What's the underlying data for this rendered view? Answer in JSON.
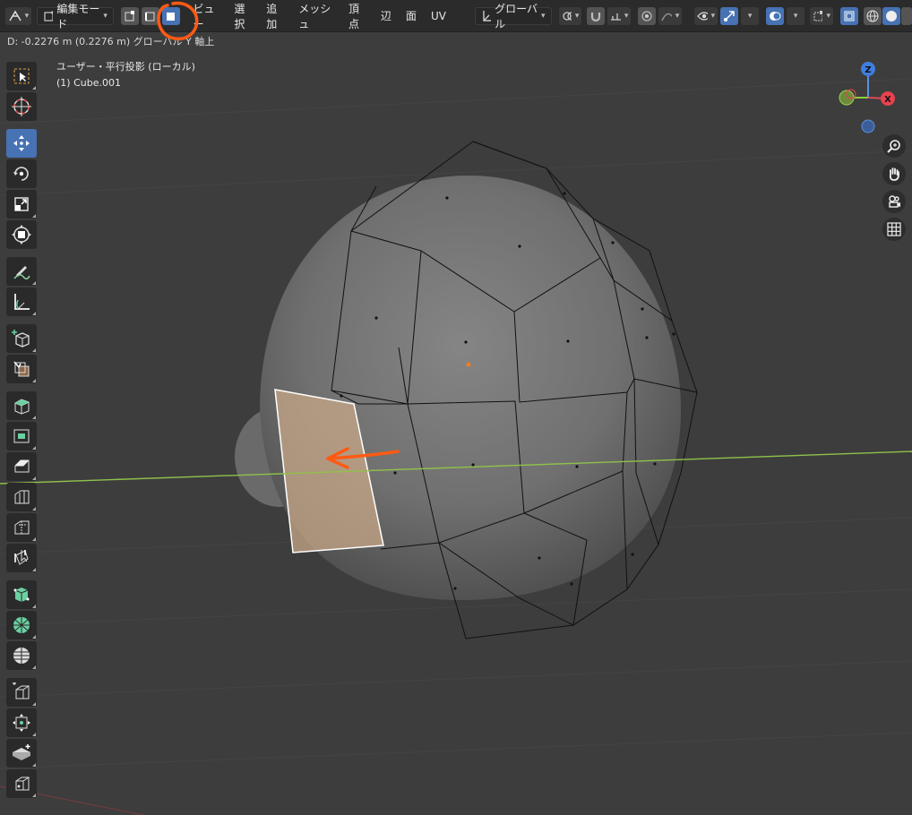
{
  "header": {
    "mode_select": "編集モード",
    "menus": [
      "ビュー",
      "選択",
      "追加",
      "メッシュ",
      "頂点",
      "辺",
      "面",
      "UV"
    ],
    "transform_orientation": "グローバル"
  },
  "status": {
    "operation_text": "D: -0.2276 m (0.2276 m) グローバル Y 軸上"
  },
  "viewport": {
    "view_name": "ユーザー・平行投影 (ローカル)",
    "object_name": "(1) Cube.001"
  },
  "gizmo": {
    "z": "Z",
    "x": "X"
  },
  "icons": [
    "select-box-icon",
    "cursor-icon",
    "move-icon",
    "rotate-icon",
    "scale-icon",
    "transform-icon",
    "annotate-icon",
    "measure-icon",
    "add-cube-icon",
    "extrude-region-icon",
    "inset-faces-icon",
    "bevel-icon",
    "loop-cut-icon",
    "offset-edge-icon",
    "knife-icon",
    "poly-build-icon",
    "spin-icon",
    "smooth-icon",
    "edge-slide-icon",
    "shrink-fatten-icon",
    "shear-icon",
    "rip-icon",
    "zoom-icon",
    "hand-pan-icon",
    "camera-icon",
    "grid-icon"
  ],
  "colors": {
    "selected_face": "#c8a888",
    "y_axis_line": "#8fc14a",
    "annotation": "#ff5a14",
    "active_blue": "#4772b3"
  }
}
